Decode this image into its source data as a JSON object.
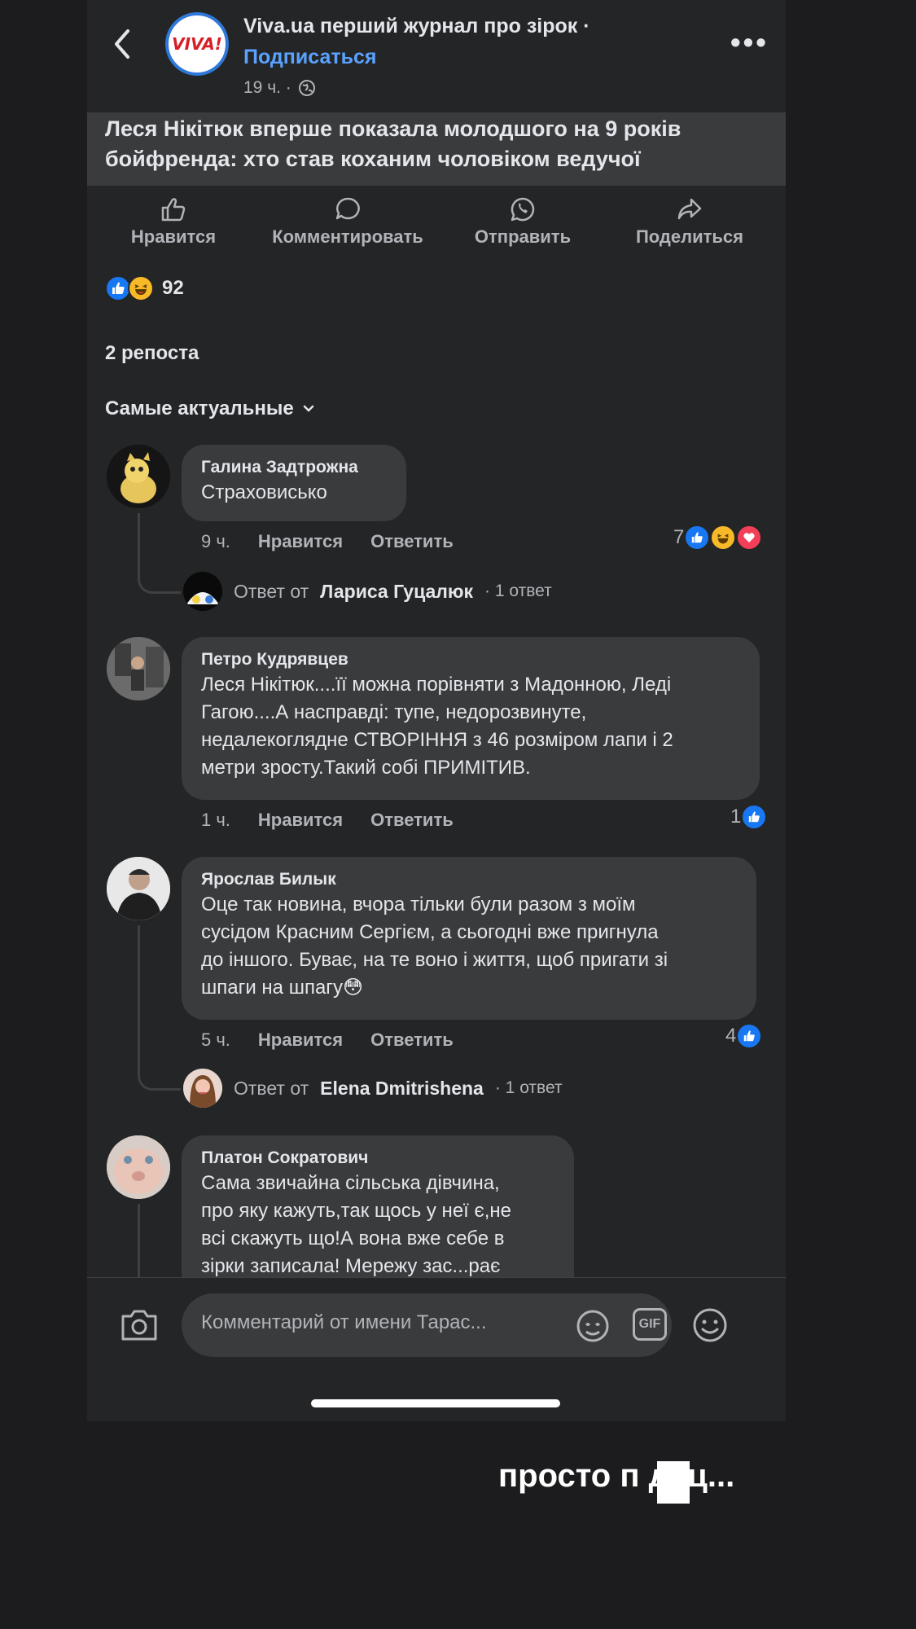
{
  "header": {
    "page_name": "Viva.ua перший журнал про зірок ·",
    "subscribe": "Подписаться",
    "time": "19 ч. ·",
    "logo_text": "VIVA!"
  },
  "post": {
    "title": "Леся Нікітюк вперше показала молодшого на 9 років бойфренда: хто став коханим чоловіком ведучої"
  },
  "actions": [
    {
      "label": "Нравится",
      "icon": "like-icon"
    },
    {
      "label": "Комментировать",
      "icon": "comment-icon"
    },
    {
      "label": "Отправить",
      "icon": "whatsapp-icon"
    },
    {
      "label": "Поделиться",
      "icon": "share-icon"
    }
  ],
  "reactions": {
    "count": "92"
  },
  "reposts": "2 репоста",
  "sort": "Самые актуальные",
  "comments": [
    {
      "name": "Галина Задтрожна",
      "text": "Страховисько",
      "time": "9 ч.",
      "like": "Нравится",
      "reply": "Ответить",
      "count": "7",
      "reply_prefix": "Ответ от",
      "reply_name": "Лариса Гуцалюк",
      "reply_count": "· 1 ответ"
    },
    {
      "name": "Петро Кудрявцев",
      "text_lines": [
        "Леся Нікітюк....її можна порівняти з Мадонною, Леді",
        "Гагою....А насправді: тупе, недорозвинуте,",
        "недалекоглядне СТВОРІННЯ з 46 розміром лапи і 2",
        "метри зросту.Такий собі ПРИМІТИВ."
      ],
      "time": "1 ч.",
      "like": "Нравится",
      "reply": "Ответить",
      "count": "1"
    },
    {
      "name": "Ярослав Билык",
      "text_lines": [
        "Оце так новина, вчора тільки були разом з моїм",
        "сусідом Красним Сергієм, а сьогодні вже пригнула",
        "до іншого. Буває, на те воно і життя, щоб пригати зі",
        "шпаги на шпагу😳"
      ],
      "time": "5 ч.",
      "like": "Нравится",
      "reply": "Ответить",
      "count": "4",
      "reply_prefix": "Ответ от",
      "reply_name": "Elena Dmitrishena",
      "reply_count": "· 1 ответ"
    },
    {
      "name": "Платон Сократович",
      "text_lines": [
        "Сама звичайна сільська дівчина,",
        "про яку кажуть,так щось у неї є,не",
        "всі скажуть що!А вона вже себе в",
        "зірки записала! Мережу зас...рає"
      ]
    }
  ],
  "composer": {
    "placeholder": "Комментарий от имени Тарас...",
    "gif_label": "GIF"
  },
  "caption": "просто п  дец...",
  "colors": {
    "accent": "#5aa2ff",
    "like": "#1877f2",
    "bubble": "#3a3b3c",
    "background": "#242526"
  }
}
